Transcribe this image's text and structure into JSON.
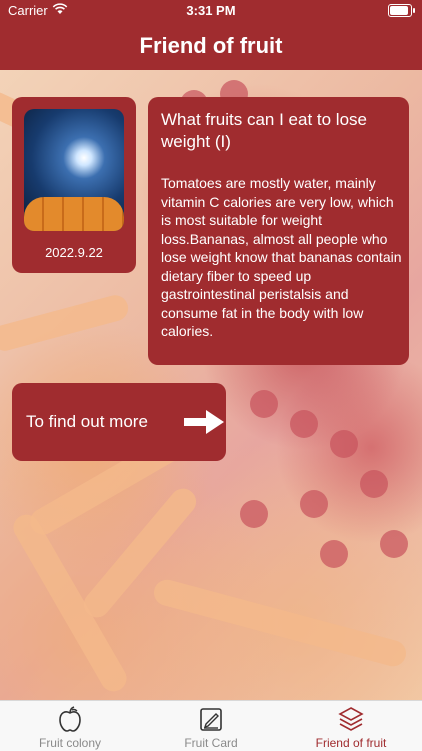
{
  "status_bar": {
    "carrier": "Carrier",
    "time": "3:31 PM"
  },
  "nav": {
    "title": "Friend of fruit"
  },
  "photo_card": {
    "date": "2022.9.22"
  },
  "article": {
    "title": "What fruits can I eat to lose weight (I)",
    "body": "Tomatoes are mostly water, mainly vitamin C calories are very low, which is most suitable for weight loss.Bananas, almost all people who lose weight know that bananas contain dietary fiber to speed up gastrointestinal peristalsis and consume fat in the body with low calories."
  },
  "more_button": {
    "label": "To find out more"
  },
  "tabs": [
    {
      "label": "Fruit colony",
      "icon": "apple-icon"
    },
    {
      "label": "Fruit Card",
      "icon": "edit-card-icon"
    },
    {
      "label": "Friend of fruit",
      "icon": "layers-icon"
    }
  ],
  "colors": {
    "accent": "#a02c2f",
    "tab_inactive": "#8a8a8a"
  }
}
